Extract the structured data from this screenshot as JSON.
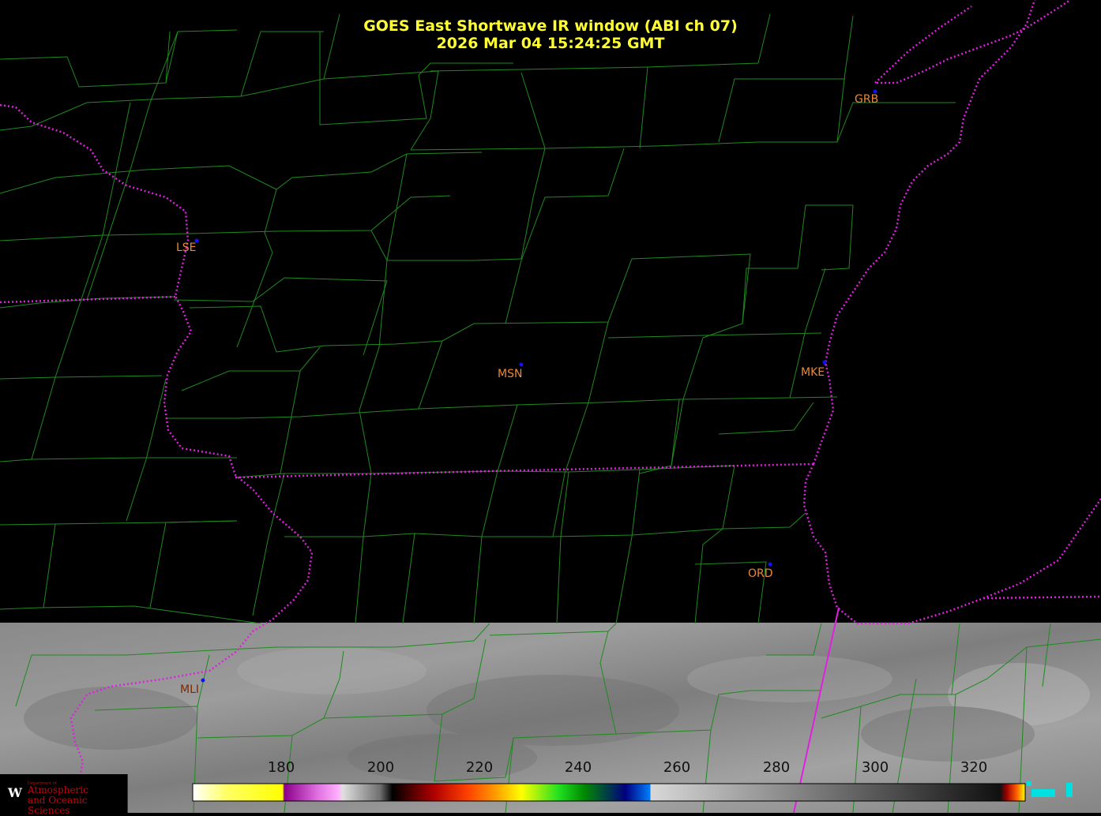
{
  "title": {
    "line1": "GOES East Shortwave IR window (ABI ch 07)",
    "line2": "2026 Mar 04  15:24:25 GMT"
  },
  "stations": [
    {
      "id": "GRB"
    },
    {
      "id": "LSE"
    },
    {
      "id": "MSN"
    },
    {
      "id": "MKE"
    },
    {
      "id": "ORD"
    },
    {
      "id": "MLI"
    }
  ],
  "colorbar": {
    "ticks": [
      "180",
      "200",
      "220",
      "240",
      "260",
      "280",
      "300",
      "320"
    ]
  },
  "logo": {
    "small_text": "Department of",
    "line1": "Atmospheric",
    "line2": "and Oceanic Sciences",
    "emblem": "W"
  },
  "colors": {
    "title": "#ffff33",
    "county_lines": "#1f8a1f",
    "state_lines": "#e020e0",
    "station_label": "#e8893a",
    "station_dot": "#1010ff"
  }
}
